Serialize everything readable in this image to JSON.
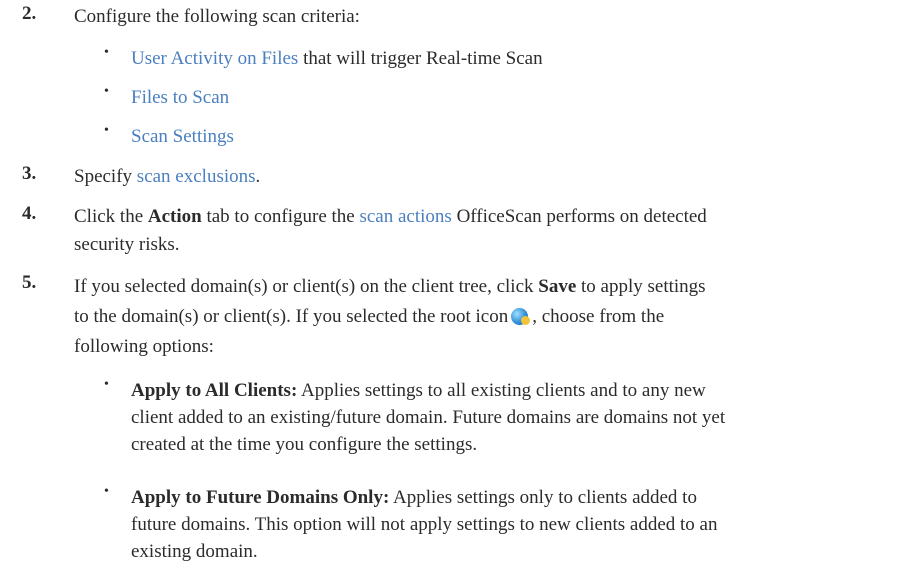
{
  "steps": [
    {
      "number": "2.",
      "text": "Configure the following scan criteria:",
      "bullets": [
        {
          "link": "User Activity on Files",
          "rest": " that will trigger Real-time Scan"
        },
        {
          "link": "Files to Scan",
          "rest": ""
        },
        {
          "link": "Scan Settings",
          "rest": ""
        }
      ]
    },
    {
      "number": "3.",
      "prefix": "Specify ",
      "link": "scan exclusions",
      "suffix": "."
    },
    {
      "number": "4.",
      "prefix": "Click the ",
      "bold": "Action",
      "middle": " tab to configure the ",
      "link": "scan actions",
      "suffix_line1": " OfficeScan performs on detected",
      "line2": "security risks."
    },
    {
      "number": "5.",
      "line1_prefix": "If you selected domain(s) or client(s) on the client tree, click ",
      "line1_bold": "Save",
      "line1_suffix": " to apply settings",
      "line2_prefix": "to the domain(s) or client(s). If you selected the root icon",
      "line2_suffix": ", choose from the",
      "line3": "following options:",
      "root_icon": "root-globe-icon",
      "options": [
        {
          "bold": "Apply to All Clients:",
          "line1": " Applies settings to all existing clients and to any new",
          "line2": "client added to an existing/future domain. Future domains are domains not yet",
          "line3": "created at the time you configure the settings."
        },
        {
          "bold": "Apply to Future Domains Only:",
          "line1": " Applies settings only to clients added to",
          "line2": "future domains. This option will not apply settings to new clients added to an",
          "line3": "existing domain."
        }
      ]
    }
  ],
  "bullet_glyph": "•",
  "colors": {
    "link": "#4a7fc0",
    "text": "#2b2b2b"
  }
}
